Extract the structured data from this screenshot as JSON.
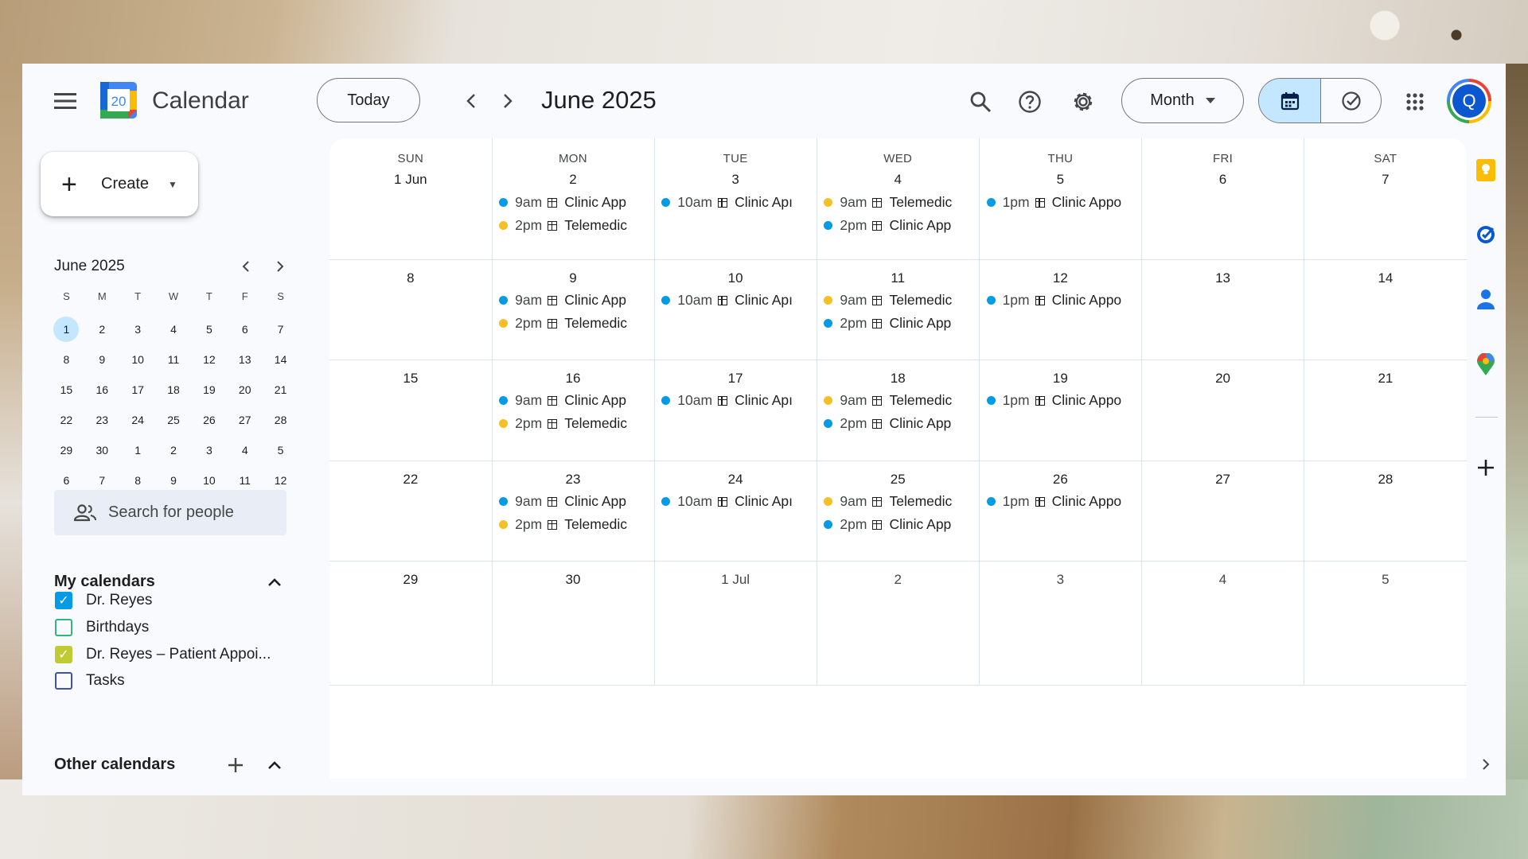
{
  "header": {
    "app_title": "Calendar",
    "logo_day": "20",
    "today_label": "Today",
    "current_period": "June 2025",
    "view_selector": "Month",
    "avatar_initial": "Q"
  },
  "sidebar": {
    "create_label": "Create",
    "mini_calendar": {
      "title": "June 2025",
      "weekdays": [
        "S",
        "M",
        "T",
        "W",
        "T",
        "F",
        "S"
      ],
      "weeks": [
        [
          "1",
          "2",
          "3",
          "4",
          "5",
          "6",
          "7"
        ],
        [
          "8",
          "9",
          "10",
          "11",
          "12",
          "13",
          "14"
        ],
        [
          "15",
          "16",
          "17",
          "18",
          "19",
          "20",
          "21"
        ],
        [
          "22",
          "23",
          "24",
          "25",
          "26",
          "27",
          "28"
        ],
        [
          "29",
          "30",
          "1",
          "2",
          "3",
          "4",
          "5"
        ],
        [
          "6",
          "7",
          "8",
          "9",
          "10",
          "11",
          "12"
        ]
      ],
      "selected": "1"
    },
    "search_people_placeholder": "Search for people",
    "my_calendars_title": "My calendars",
    "my_calendars": [
      {
        "name": "Dr. Reyes",
        "checked": true,
        "color": "#039be5"
      },
      {
        "name": "Birthdays",
        "checked": false,
        "color": "#33b679"
      },
      {
        "name": "Dr. Reyes – Patient Appoi...",
        "checked": true,
        "color": "#c0ca33"
      },
      {
        "name": "Tasks",
        "checked": false,
        "color": "#3f51b5"
      }
    ],
    "other_calendars_title": "Other calendars"
  },
  "colors": {
    "clinic": "#039be5",
    "telemedicine": "#f6bf26",
    "selected_bg": "#c2e7ff"
  },
  "month_grid": {
    "weekdays": [
      "SUN",
      "MON",
      "TUE",
      "WED",
      "THU",
      "FRI",
      "SAT"
    ],
    "weeks": [
      [
        {
          "label": "1 Jun",
          "events": []
        },
        {
          "label": "2",
          "events": [
            {
              "time": "9am",
              "title": "Clinic App",
              "type": "clinic"
            },
            {
              "time": "2pm",
              "title": "Telemedic",
              "type": "telemedicine"
            }
          ]
        },
        {
          "label": "3",
          "events": [
            {
              "time": "10am",
              "title": "Clinic Apı",
              "type": "clinic"
            }
          ]
        },
        {
          "label": "4",
          "events": [
            {
              "time": "9am",
              "title": "Telemedic",
              "type": "telemedicine"
            },
            {
              "time": "2pm",
              "title": "Clinic App",
              "type": "clinic"
            }
          ]
        },
        {
          "label": "5",
          "events": [
            {
              "time": "1pm",
              "title": "Clinic Appo",
              "type": "clinic"
            }
          ]
        },
        {
          "label": "6",
          "events": []
        },
        {
          "label": "7",
          "events": []
        }
      ],
      [
        {
          "label": "8",
          "events": []
        },
        {
          "label": "9",
          "events": [
            {
              "time": "9am",
              "title": "Clinic App",
              "type": "clinic"
            },
            {
              "time": "2pm",
              "title": "Telemedic",
              "type": "telemedicine"
            }
          ]
        },
        {
          "label": "10",
          "events": [
            {
              "time": "10am",
              "title": "Clinic Apı",
              "type": "clinic"
            }
          ]
        },
        {
          "label": "11",
          "events": [
            {
              "time": "9am",
              "title": "Telemedic",
              "type": "telemedicine"
            },
            {
              "time": "2pm",
              "title": "Clinic App",
              "type": "clinic"
            }
          ]
        },
        {
          "label": "12",
          "events": [
            {
              "time": "1pm",
              "title": "Clinic Appo",
              "type": "clinic"
            }
          ]
        },
        {
          "label": "13",
          "events": []
        },
        {
          "label": "14",
          "events": []
        }
      ],
      [
        {
          "label": "15",
          "events": []
        },
        {
          "label": "16",
          "events": [
            {
              "time": "9am",
              "title": "Clinic App",
              "type": "clinic"
            },
            {
              "time": "2pm",
              "title": "Telemedic",
              "type": "telemedicine"
            }
          ]
        },
        {
          "label": "17",
          "events": [
            {
              "time": "10am",
              "title": "Clinic Apı",
              "type": "clinic"
            }
          ]
        },
        {
          "label": "18",
          "events": [
            {
              "time": "9am",
              "title": "Telemedic",
              "type": "telemedicine"
            },
            {
              "time": "2pm",
              "title": "Clinic App",
              "type": "clinic"
            }
          ]
        },
        {
          "label": "19",
          "events": [
            {
              "time": "1pm",
              "title": "Clinic Appo",
              "type": "clinic"
            }
          ]
        },
        {
          "label": "20",
          "events": []
        },
        {
          "label": "21",
          "events": []
        }
      ],
      [
        {
          "label": "22",
          "events": []
        },
        {
          "label": "23",
          "events": [
            {
              "time": "9am",
              "title": "Clinic App",
              "type": "clinic"
            },
            {
              "time": "2pm",
              "title": "Telemedic",
              "type": "telemedicine"
            }
          ]
        },
        {
          "label": "24",
          "events": [
            {
              "time": "10am",
              "title": "Clinic Apı",
              "type": "clinic"
            }
          ]
        },
        {
          "label": "25",
          "events": [
            {
              "time": "9am",
              "title": "Telemedic",
              "type": "telemedicine"
            },
            {
              "time": "2pm",
              "title": "Clinic App",
              "type": "clinic"
            }
          ]
        },
        {
          "label": "26",
          "events": [
            {
              "time": "1pm",
              "title": "Clinic Appo",
              "type": "clinic"
            }
          ]
        },
        {
          "label": "27",
          "events": []
        },
        {
          "label": "28",
          "events": []
        }
      ],
      [
        {
          "label": "29",
          "events": []
        },
        {
          "label": "30",
          "events": []
        },
        {
          "label": "1 Jul",
          "events": [],
          "other_month": true
        },
        {
          "label": "2",
          "events": [],
          "other_month": true
        },
        {
          "label": "3",
          "events": [],
          "other_month": true
        },
        {
          "label": "4",
          "events": [],
          "other_month": true
        },
        {
          "label": "5",
          "events": [],
          "other_month": true
        }
      ]
    ]
  },
  "right_rail": {
    "icons": [
      "keep-icon",
      "tasks-icon",
      "contacts-icon",
      "maps-icon",
      "add-icon",
      "expand-chevron-icon"
    ]
  }
}
